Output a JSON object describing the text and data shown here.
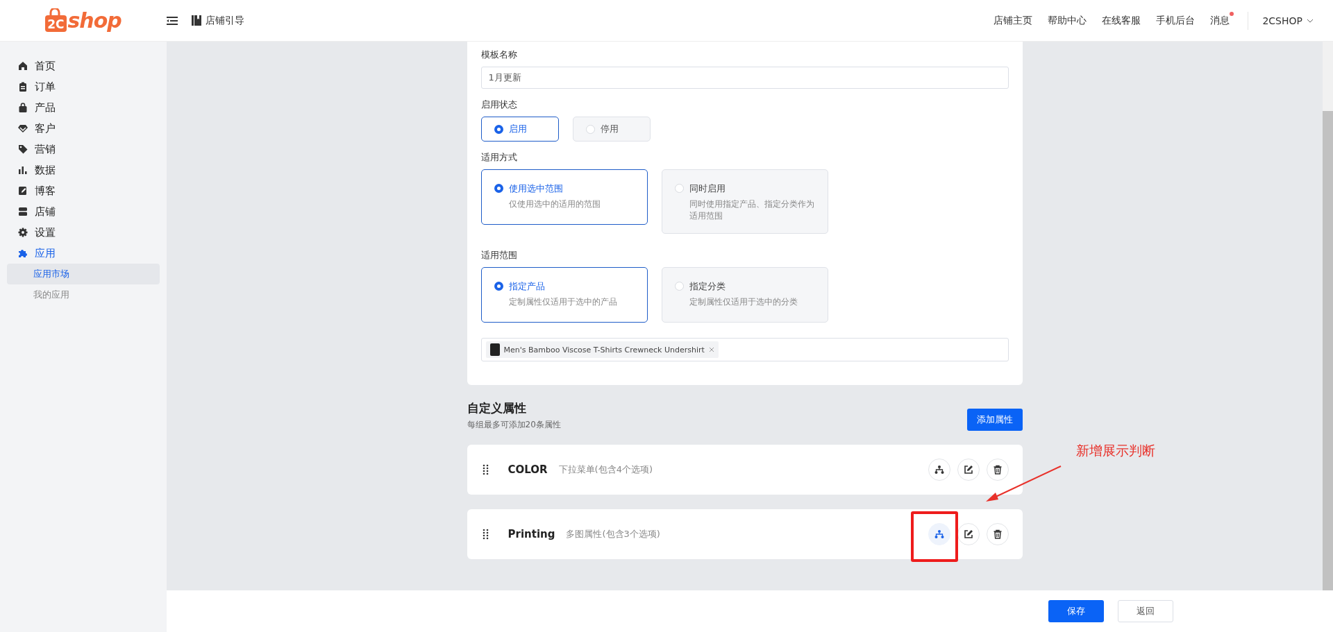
{
  "header": {
    "logo": {
      "badge": "2C",
      "text": "shop"
    },
    "guide": "店铺引导",
    "links": [
      {
        "label": "店铺主页",
        "unread": false
      },
      {
        "label": "帮助中心",
        "unread": false
      },
      {
        "label": "在线客服",
        "unread": false
      },
      {
        "label": "手机后台",
        "unread": false
      },
      {
        "label": "消息",
        "unread": true
      }
    ],
    "account": "2CSHOP"
  },
  "sidebar": {
    "items": [
      {
        "label": "首页",
        "selected": false
      },
      {
        "label": "订单",
        "selected": false
      },
      {
        "label": "产品",
        "selected": false
      },
      {
        "label": "客户",
        "selected": false
      },
      {
        "label": "营销",
        "selected": false
      },
      {
        "label": "数据",
        "selected": false
      },
      {
        "label": "博客",
        "selected": false
      },
      {
        "label": "店铺",
        "selected": false
      },
      {
        "label": "设置",
        "selected": false
      },
      {
        "label": "应用",
        "selected": true,
        "children": [
          {
            "label": "应用市场",
            "selected": true
          },
          {
            "label": "我的应用",
            "selected": false
          }
        ]
      }
    ]
  },
  "form": {
    "fields": [
      {
        "kind": "text",
        "label": "模板名称",
        "value": "1月更新"
      },
      {
        "kind": "radio",
        "label": "启用状态",
        "options": [
          {
            "label": "启用",
            "selected": true
          },
          {
            "label": "停用",
            "selected": false
          }
        ]
      },
      {
        "kind": "cards",
        "label": "适用方式",
        "options": [
          {
            "label": "使用选中范围",
            "description": "仅使用选中的适用的范围",
            "selected": true
          },
          {
            "label": "同时启用",
            "description": "同时使用指定产品、指定分类作为适用范围",
            "selected": false
          }
        ]
      },
      {
        "kind": "cards",
        "label": "适用范围",
        "options": [
          {
            "label": "指定产品",
            "description": "定制属性仅适用于选中的产品",
            "selected": true
          },
          {
            "label": "指定分类",
            "description": "定制属性仅适用于选中的分类",
            "selected": false
          }
        ]
      },
      {
        "kind": "tags",
        "tags": [
          "Men's Bamboo Viscose T-Shirts Crewneck Undershirt"
        ]
      }
    ]
  },
  "attributes": {
    "title": "自定义属性",
    "subtitle": "每组最多可添加20条属性",
    "add_button": "添加属性",
    "rows": [
      {
        "name": "COLOR",
        "description": "下拉菜单(包含4个选项)",
        "condition_set": false
      },
      {
        "name": "Printing",
        "description": "多图属性(包含3个选项)",
        "condition_set": true
      }
    ]
  },
  "annotation": {
    "text": "新增展示判断"
  },
  "footer": {
    "buttons": [
      {
        "label": "保存",
        "kind": "primary"
      },
      {
        "label": "返回",
        "kind": "default"
      }
    ]
  }
}
